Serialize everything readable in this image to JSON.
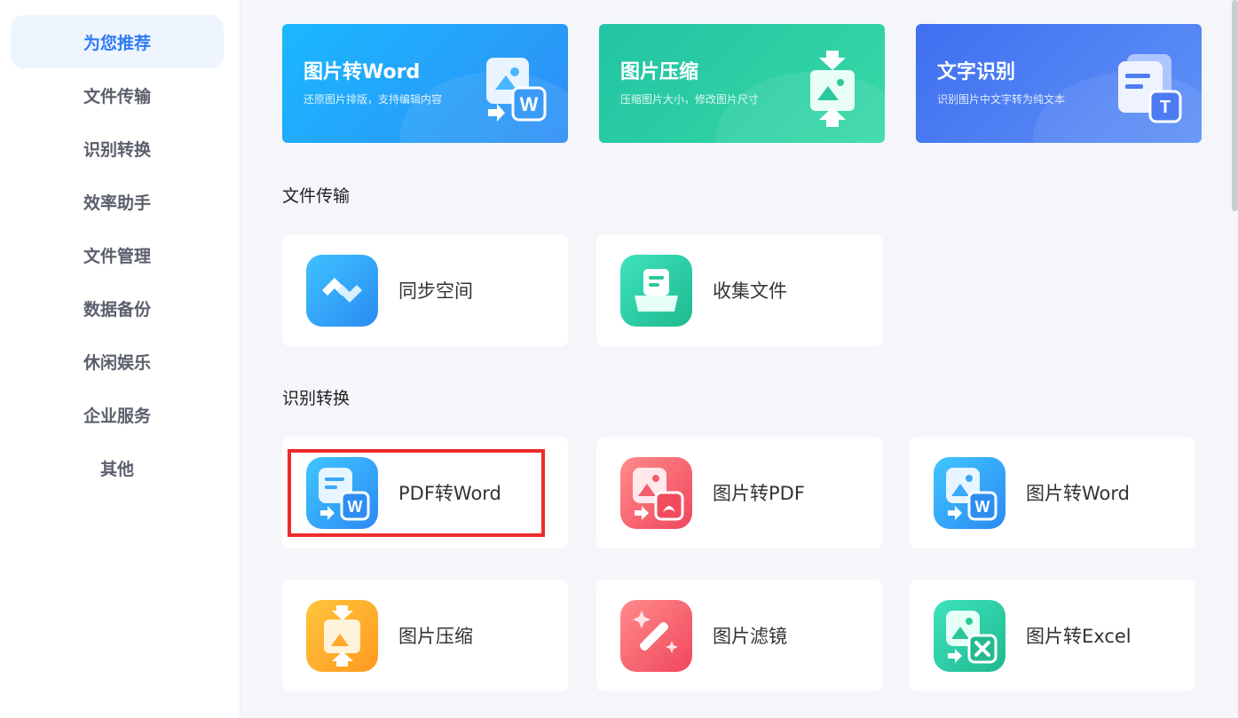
{
  "sidebar": {
    "items": [
      {
        "label": "为您推荐",
        "active": true
      },
      {
        "label": "文件传输"
      },
      {
        "label": "识别转换"
      },
      {
        "label": "效率助手"
      },
      {
        "label": "文件管理"
      },
      {
        "label": "数据备份"
      },
      {
        "label": "休闲娱乐"
      },
      {
        "label": "企业服务"
      },
      {
        "label": "其他"
      }
    ]
  },
  "banners": [
    {
      "title": "图片转Word",
      "subtitle": "还原图片排版，支持编辑内容",
      "color": "#27a3ff",
      "icon": "image-to-word-icon"
    },
    {
      "title": "图片压缩",
      "subtitle": "压缩图片大小，修改图片尺寸",
      "color": "#2fc99a",
      "icon": "image-compress-icon"
    },
    {
      "title": "文字识别",
      "subtitle": "识别图片中文字转为纯文本",
      "color": "#4d7cf2",
      "icon": "text-recognition-icon"
    }
  ],
  "sections": {
    "file_transfer": {
      "title": "文件传输",
      "cards": [
        {
          "label": "同步空间",
          "icon": "sync-space-icon"
        },
        {
          "label": "收集文件",
          "icon": "collect-files-icon"
        }
      ]
    },
    "recognition": {
      "title": "识别转换",
      "cards": [
        {
          "label": "PDF转Word",
          "icon": "pdf-to-word-icon"
        },
        {
          "label": "图片转PDF",
          "icon": "image-to-pdf-icon"
        },
        {
          "label": "图片转Word",
          "icon": "image-to-word-icon"
        },
        {
          "label": "图片压缩",
          "icon": "image-compress-icon"
        },
        {
          "label": "图片滤镜",
          "icon": "image-filter-icon"
        },
        {
          "label": "图片转Excel",
          "icon": "image-to-excel-icon"
        }
      ]
    }
  }
}
